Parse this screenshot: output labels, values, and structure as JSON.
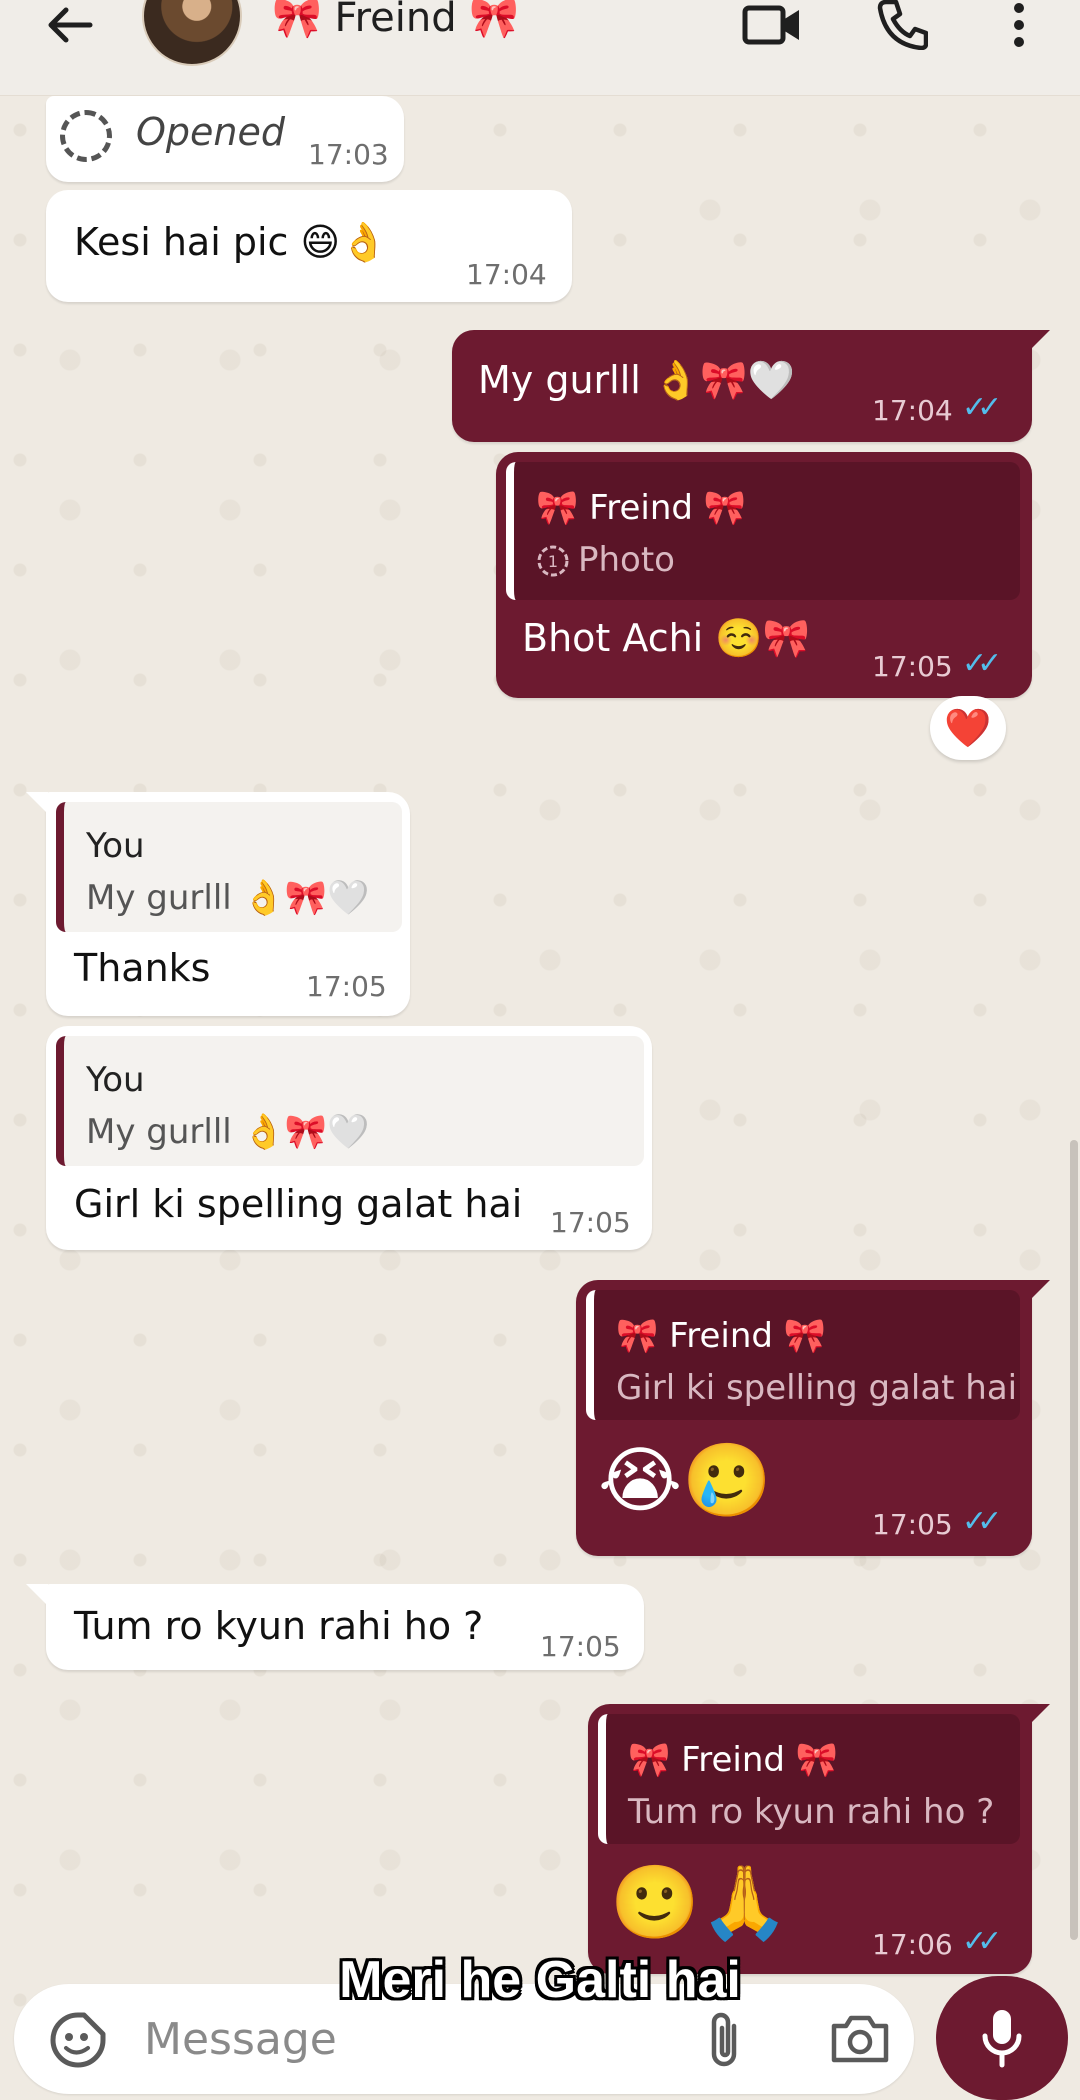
{
  "header": {
    "contact_name": "🎀 Freind 🎀",
    "icons": {
      "back": "arrow-left-icon",
      "video": "video-call-icon",
      "call": "phone-icon",
      "menu": "more-vert-icon"
    }
  },
  "messages": [
    {
      "id": "m1",
      "dir": "in",
      "text": "Opened",
      "time": "17:03",
      "icon": "view-once-opened-icon"
    },
    {
      "id": "m2",
      "dir": "in",
      "text": "Kesi hai pic 😄👌",
      "time": "17:04"
    },
    {
      "id": "m3",
      "dir": "out",
      "text": "My gurlll 👌🎀🤍",
      "time": "17:04"
    },
    {
      "id": "m4",
      "dir": "out",
      "quote_name": "🎀 Freind 🎀",
      "quote_body": "Photo",
      "text": "Bhot Achi ☺️🎀",
      "time": "17:05",
      "reaction": "❤️"
    },
    {
      "id": "m5",
      "dir": "in",
      "quote_name": "You",
      "quote_body": "My gurlll 👌🎀🤍",
      "text": "Thanks",
      "time": "17:05"
    },
    {
      "id": "m6",
      "dir": "in",
      "quote_name": "You",
      "quote_body": "My gurlll 👌🎀🤍",
      "text": "Girl ki spelling galat hai",
      "time": "17:05"
    },
    {
      "id": "m7",
      "dir": "out",
      "quote_name": "🎀 Freind 🎀",
      "quote_body": "Girl ki spelling galat hai",
      "text": "😭🥲",
      "time": "17:05"
    },
    {
      "id": "m8",
      "dir": "in",
      "text": "Tum ro kyun rahi ho ?",
      "time": "17:05"
    },
    {
      "id": "m9",
      "dir": "out",
      "quote_name": "🎀 Freind 🎀",
      "quote_body": "Tum ro kyun rahi ho ?",
      "text": "🙂🙏",
      "time": "17:06"
    }
  ],
  "read_ticks": "✓✓",
  "subtitle": "Meri he Galti hai",
  "composer": {
    "placeholder": "Message",
    "icons": {
      "sticker": "sticker-icon",
      "attach": "paperclip-icon",
      "camera": "camera-icon",
      "mic": "microphone-icon"
    }
  },
  "colors": {
    "outgoing": "#6d1a30",
    "incoming": "#ffffff",
    "background": "#efeae2",
    "tick": "#53bdeb"
  }
}
